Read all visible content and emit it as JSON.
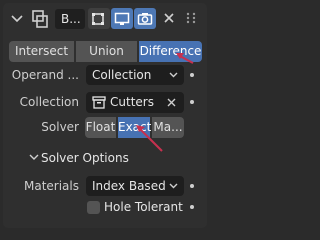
{
  "header": {
    "modifier_name": "B...",
    "visibility_buttons": [
      "edit-mode-icon",
      "viewport-display-icon",
      "render-camera-icon"
    ],
    "close_icon": "close-icon",
    "grip_icon": "drag-grip-icon"
  },
  "operation": {
    "options": [
      "Intersect",
      "Union",
      "Difference"
    ],
    "selected": "Difference"
  },
  "operand_type": {
    "label": "Operand ...",
    "value": "Collection"
  },
  "collection": {
    "label": "Collection",
    "value": "Cutters"
  },
  "solver": {
    "label": "Solver",
    "options": [
      "Float",
      "Exact",
      "Ma..."
    ],
    "selected": "Exact"
  },
  "solver_options": {
    "title": "Solver Options",
    "materials": {
      "label": "Materials",
      "value": "Index Based"
    },
    "hole_tolerant": {
      "label": "Hole Tolerant",
      "checked": false
    }
  },
  "colors": {
    "accent": "#4772b3",
    "annotation_arrow": "#c7304f"
  }
}
